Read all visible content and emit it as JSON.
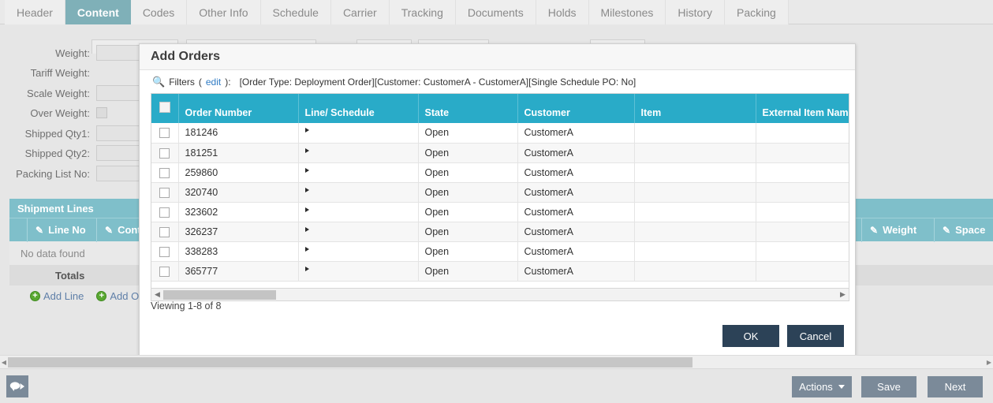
{
  "tabs": [
    {
      "label": "Header",
      "active": false
    },
    {
      "label": "Content",
      "active": true
    },
    {
      "label": "Codes",
      "active": false
    },
    {
      "label": "Other Info",
      "active": false
    },
    {
      "label": "Schedule",
      "active": false
    },
    {
      "label": "Carrier",
      "active": false
    },
    {
      "label": "Tracking",
      "active": false
    },
    {
      "label": "Documents",
      "active": false
    },
    {
      "label": "Holds",
      "active": false
    },
    {
      "label": "Milestones",
      "active": false
    },
    {
      "label": "History",
      "active": false
    },
    {
      "label": "Packing",
      "active": false
    }
  ],
  "form": {
    "fields": [
      {
        "label": "Weight:",
        "type": "text",
        "value": ""
      },
      {
        "label": "Tariff Weight:",
        "type": "none",
        "value": ""
      },
      {
        "label": "Scale Weight:",
        "type": "text",
        "value": ""
      },
      {
        "label": "Over Weight:",
        "type": "checkbox",
        "value": ""
      },
      {
        "label": "Shipped Qty1:",
        "type": "text",
        "value": ""
      },
      {
        "label": "Shipped Qty2:",
        "type": "text",
        "value": ""
      },
      {
        "label": "Packing List No:",
        "type": "text",
        "value": ""
      }
    ]
  },
  "shipment_lines": {
    "title": "Shipment Lines",
    "columns": [
      "Line No",
      "Content",
      "Weight",
      "Space"
    ],
    "empty_text": "No data found",
    "totals_label": "Totals",
    "actions": [
      {
        "label": "Add Line",
        "icon": "plus-circle-icon"
      },
      {
        "label": "Add Orders",
        "icon": "plus-circle-icon"
      }
    ]
  },
  "modal": {
    "title": "Add Orders",
    "filters": {
      "icon": "search-icon",
      "label": "Filters",
      "edit_link": "edit",
      "colon": "):",
      "open_paren": "(",
      "values": "[Order Type: Deployment Order][Customer: CustomerA - CustomerA][Single Schedule PO: No]"
    },
    "grid": {
      "columns": [
        "Order Number",
        "Line/ Schedule",
        "State",
        "Customer",
        "Item",
        "External Item Name"
      ],
      "rows": [
        {
          "order_number": "181246",
          "line_schedule": "",
          "state": "Open",
          "customer": "CustomerA",
          "item": "",
          "external_item_name": ""
        },
        {
          "order_number": "181251",
          "line_schedule": "",
          "state": "Open",
          "customer": "CustomerA",
          "item": "",
          "external_item_name": ""
        },
        {
          "order_number": "259860",
          "line_schedule": "",
          "state": "Open",
          "customer": "CustomerA",
          "item": "",
          "external_item_name": ""
        },
        {
          "order_number": "320740",
          "line_schedule": "",
          "state": "Open",
          "customer": "CustomerA",
          "item": "",
          "external_item_name": ""
        },
        {
          "order_number": "323602",
          "line_schedule": "",
          "state": "Open",
          "customer": "CustomerA",
          "item": "",
          "external_item_name": ""
        },
        {
          "order_number": "326237",
          "line_schedule": "",
          "state": "Open",
          "customer": "CustomerA",
          "item": "",
          "external_item_name": ""
        },
        {
          "order_number": "338283",
          "line_schedule": "",
          "state": "Open",
          "customer": "CustomerA",
          "item": "",
          "external_item_name": ""
        },
        {
          "order_number": "365777",
          "line_schedule": "",
          "state": "Open",
          "customer": "CustomerA",
          "item": "",
          "external_item_name": ""
        }
      ]
    },
    "viewing_text": "Viewing 1-8 of 8",
    "ok_label": "OK",
    "cancel_label": "Cancel"
  },
  "bottom_bar": {
    "chat_icon": "chat-bubble-icon",
    "actions_label": "Actions",
    "save_label": "Save",
    "next_label": "Next"
  },
  "colors": {
    "accent_teal": "#29abc8",
    "panel_teal": "#7fbfca",
    "active_tab": "#7fb0b8",
    "navy_button": "#2c4257",
    "slate_button": "#7b8a99",
    "link_blue": "#2f7bc4",
    "add_green": "#5aa832"
  }
}
